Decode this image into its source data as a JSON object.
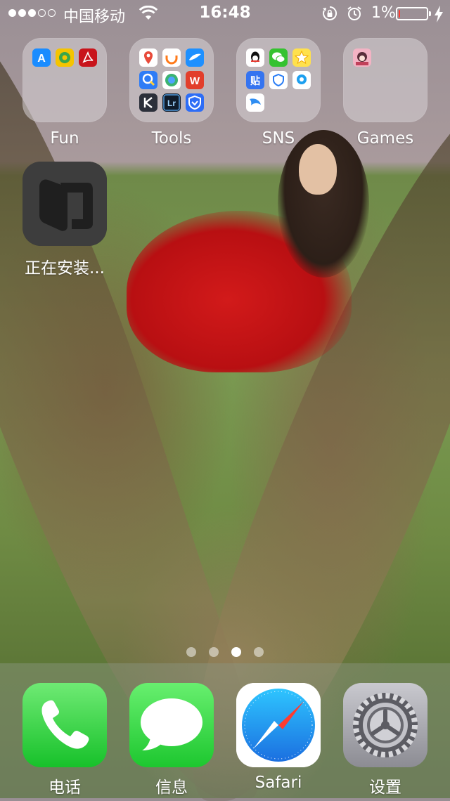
{
  "status_bar": {
    "signal_dots": [
      true,
      true,
      true,
      false,
      false
    ],
    "carrier": "中国移动",
    "time": "16:48",
    "battery_percent": "1%",
    "battery_level": 0.05
  },
  "folders": [
    {
      "name": "Fun",
      "apps": [
        "app-store-icon",
        "green-app-icon",
        "pdf-reader-icon"
      ]
    },
    {
      "name": "Tools",
      "apps": [
        "maps-icon",
        "didi-icon",
        "feather-app-icon",
        "contacts-search-icon",
        "globe-app-icon",
        "wps-office-icon",
        "k-app-icon",
        "lightroom-icon",
        "vpn-shield-icon"
      ]
    },
    {
      "name": "SNS",
      "apps": [
        "qq-icon",
        "wechat-icon",
        "star-app-icon",
        "tieba-icon",
        "shield-app-icon",
        "chat-bubble-icon",
        "feather-blue-icon"
      ]
    },
    {
      "name": "Games",
      "apps": [
        "anime-game-icon"
      ]
    }
  ],
  "installing_app": {
    "label": "正在安装..."
  },
  "page_indicator": {
    "count": 4,
    "active": 3
  },
  "dock": [
    {
      "label": "电话",
      "icon": "phone-icon"
    },
    {
      "label": "信息",
      "icon": "messages-icon"
    },
    {
      "label": "Safari",
      "icon": "safari-icon"
    },
    {
      "label": "设置",
      "icon": "settings-icon"
    }
  ],
  "colors": {
    "phone_green": "#34c759",
    "messages_green": "#4cd964",
    "safari_blue": "#1e88e5",
    "battery_red": "#ff3b30"
  }
}
